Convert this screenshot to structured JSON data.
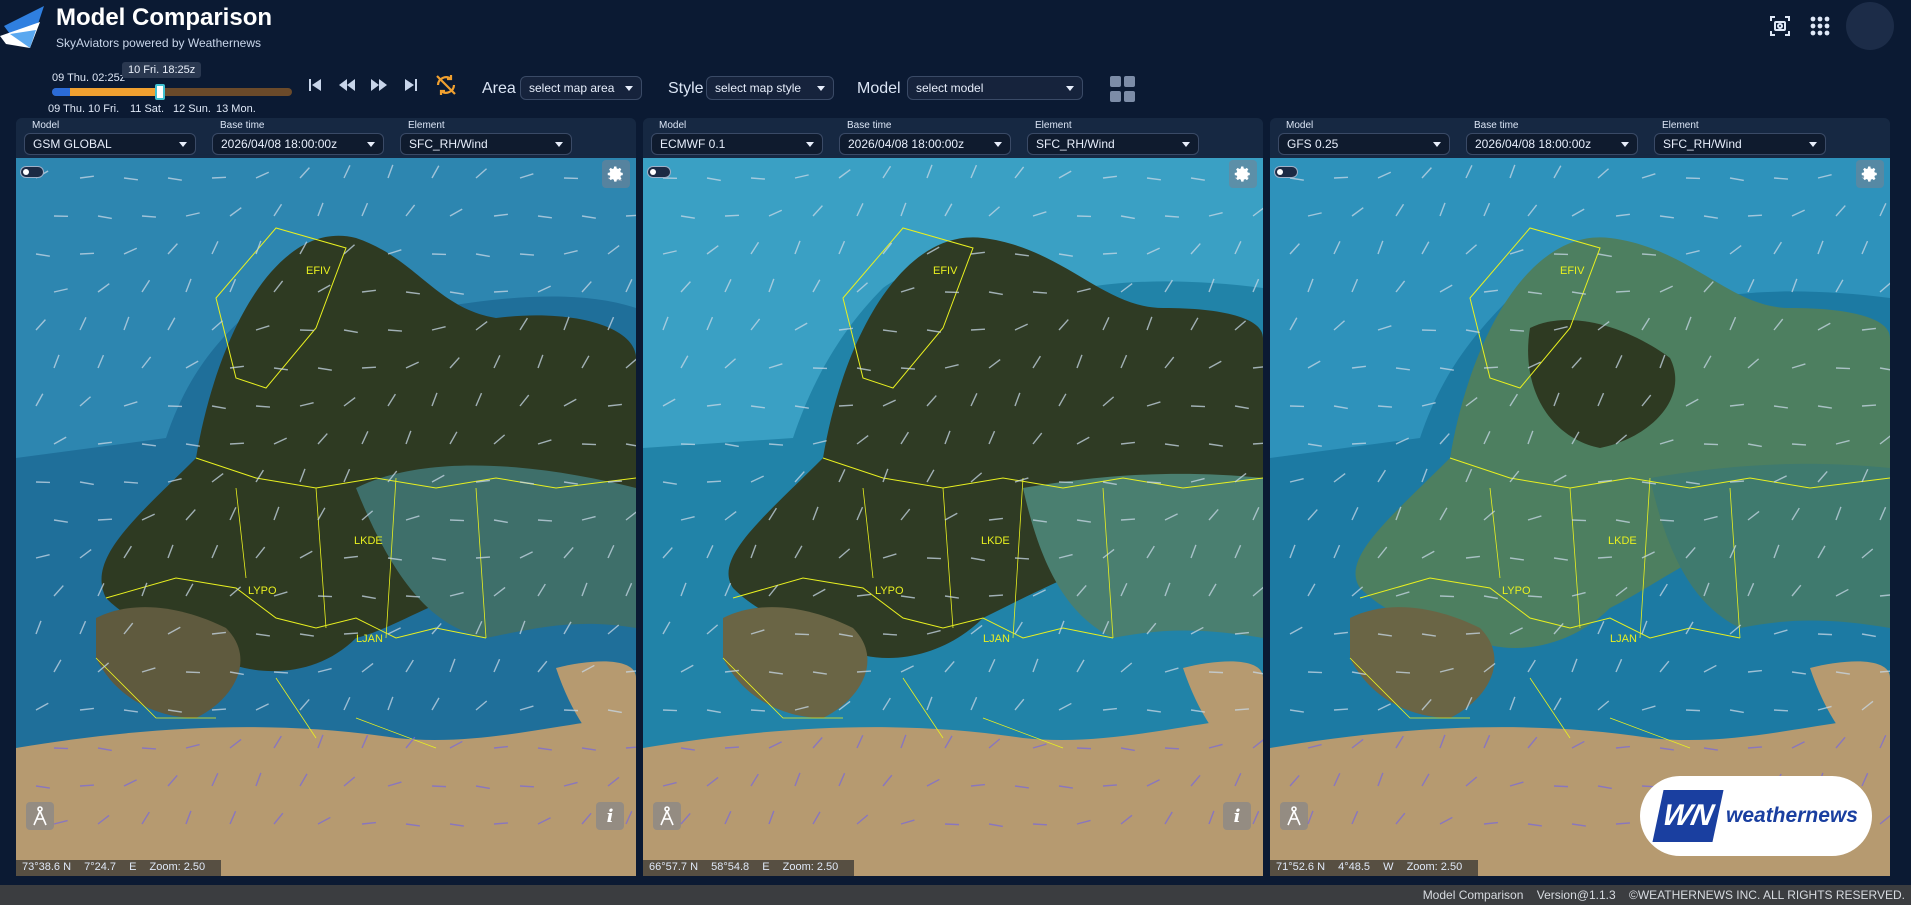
{
  "header": {
    "title": "Model Comparison",
    "subtitle": "SkyAviators powered by Weathernews"
  },
  "timeline": {
    "now_label": "09 Thu. 02:25z",
    "tooltip": "10 Fri. 18:25z",
    "day_labels": [
      "09 Thu.",
      "10 Fri.",
      "11 Sat.",
      "12 Sun.",
      "13 Mon."
    ],
    "progress_fraction": 0.45
  },
  "controls": {
    "area_label": "Area",
    "area_value": "select map area",
    "style_label": "Style",
    "style_value": "select map style",
    "model_label": "Model",
    "model_value": "select model"
  },
  "panels": [
    {
      "model_label": "Model",
      "model": "GSM GLOBAL",
      "base_label": "Base time",
      "base": "2026/04/08 18:00:00z",
      "element_label": "Element",
      "element": "SFC_RH/Wind",
      "coord_lat": "73°38.6 N",
      "coord_lon": "7°24.7",
      "coord_dir": "E",
      "zoom": "Zoom: 2.50",
      "map_labels": [
        "EFIV",
        "LKDE",
        "LYPO",
        "LJAN"
      ]
    },
    {
      "model_label": "Model",
      "model": "ECMWF 0.1",
      "base_label": "Base time",
      "base": "2026/04/08 18:00:00z",
      "element_label": "Element",
      "element": "SFC_RH/Wind",
      "coord_lat": "66°57.7 N",
      "coord_lon": "58°54.8",
      "coord_dir": "E",
      "zoom": "Zoom: 2.50",
      "map_labels": [
        "EFIV",
        "LKDE",
        "LYPO",
        "LJAN"
      ]
    },
    {
      "model_label": "Model",
      "model": "GFS 0.25",
      "base_label": "Base time",
      "base": "2026/04/08 18:00:00z",
      "element_label": "Element",
      "element": "SFC_RH/Wind",
      "coord_lat": "71°52.6 N",
      "coord_lon": "4°48.5",
      "coord_dir": "W",
      "zoom": "Zoom: 2.50",
      "map_labels": [
        "EFIV",
        "LKDE",
        "LYPO",
        "LJAN"
      ]
    }
  ],
  "brand": {
    "mark": "WN",
    "name": "weathernews"
  },
  "footer": {
    "app": "Model Comparison",
    "version": "Version@1.1.3",
    "copyright": "©WEATHERNEWS INC. ALL RIGHTS RESERVED."
  },
  "colors": {
    "background": "#0b1a33",
    "ocean": "#1f6f9a",
    "land_dry": "#b69a70",
    "land_humid": "#2e3a22",
    "border_lines": "#e8f020",
    "timeline_fill": "#f0a030",
    "brand_blue": "#1a3fa0"
  },
  "icons": [
    "app-logo-icon",
    "screenshot-icon",
    "apps-grid-icon",
    "skip-start-icon",
    "rewind-icon",
    "fast-forward-icon",
    "skip-end-icon",
    "sync-off-icon",
    "layout-grid-icon",
    "gear-icon",
    "compass-icon",
    "info-icon"
  ]
}
